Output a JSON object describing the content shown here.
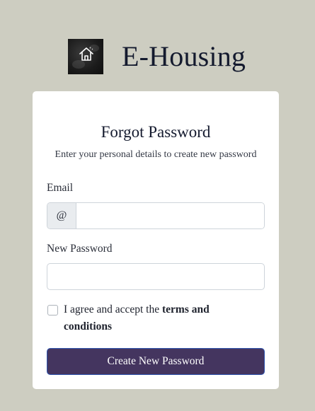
{
  "brand": {
    "title": "E-Housing",
    "logo_icon": "house-icon"
  },
  "form": {
    "title": "Forgot Password",
    "subtitle": "Enter your personal details to create new password",
    "email_label": "Email",
    "email_addon": "@",
    "email_value": "",
    "email_placeholder": "",
    "password_label": "New Password",
    "password_value": "",
    "password_placeholder": "",
    "terms_prefix": "I agree and accept the ",
    "terms_link": "terms and conditions",
    "terms_checked": false,
    "submit_label": "Create New Password"
  },
  "colors": {
    "background": "#cdcdc1",
    "card": "#ffffff",
    "button": "#44355f",
    "title": "#141a2e"
  }
}
